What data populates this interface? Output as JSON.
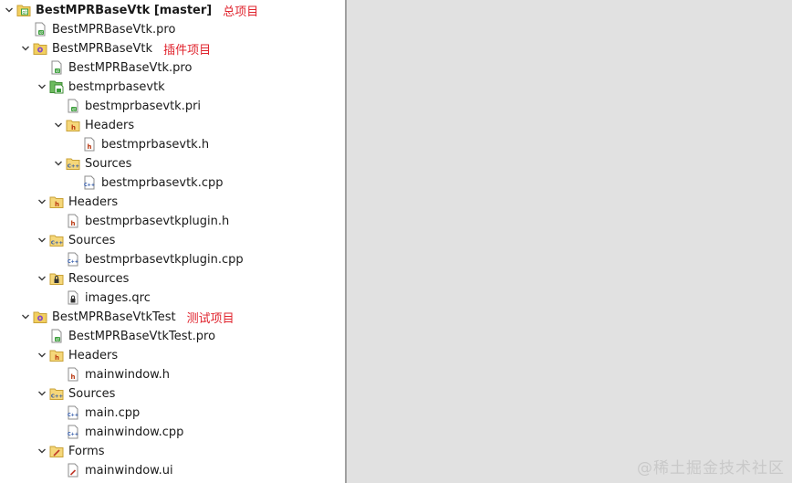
{
  "tree": [
    {
      "label": "BestMPRBaseVtk [master]",
      "icon": "qt-project-icon",
      "expanded": true,
      "bold": true,
      "annotation": "总项目"
    },
    {
      "label": "BestMPRBaseVtk.pro",
      "icon": "pro-file-icon"
    },
    {
      "label": "BestMPRBaseVtk",
      "icon": "subproject-icon",
      "expanded": true,
      "annotation": "插件项目"
    },
    {
      "label": "BestMPRBaseVtk.pro",
      "icon": "pro-file-icon"
    },
    {
      "label": "bestmprbasevtk",
      "icon": "pri-folder-icon",
      "expanded": true
    },
    {
      "label": "bestmprbasevtk.pri",
      "icon": "pro-file-icon"
    },
    {
      "label": "Headers",
      "icon": "headers-folder-icon",
      "expanded": true
    },
    {
      "label": "bestmprbasevtk.h",
      "icon": "header-file-icon"
    },
    {
      "label": "Sources",
      "icon": "sources-folder-icon",
      "expanded": true
    },
    {
      "label": "bestmprbasevtk.cpp",
      "icon": "cpp-file-icon"
    },
    {
      "label": "Headers",
      "icon": "headers-folder-icon",
      "expanded": true
    },
    {
      "label": "bestmprbasevtkplugin.h",
      "icon": "header-file-icon"
    },
    {
      "label": "Sources",
      "icon": "sources-folder-icon",
      "expanded": true
    },
    {
      "label": "bestmprbasevtkplugin.cpp",
      "icon": "cpp-file-icon"
    },
    {
      "label": "Resources",
      "icon": "resources-folder-icon",
      "expanded": true
    },
    {
      "label": "images.qrc",
      "icon": "qrc-file-icon"
    },
    {
      "label": "BestMPRBaseVtkTest",
      "icon": "subproject-icon",
      "expanded": true,
      "annotation": "测试项目"
    },
    {
      "label": "BestMPRBaseVtkTest.pro",
      "icon": "pro-file-icon"
    },
    {
      "label": "Headers",
      "icon": "headers-folder-icon",
      "expanded": true
    },
    {
      "label": "mainwindow.h",
      "icon": "header-file-icon"
    },
    {
      "label": "Sources",
      "icon": "sources-folder-icon",
      "expanded": true
    },
    {
      "label": "main.cpp",
      "icon": "cpp-file-icon"
    },
    {
      "label": "mainwindow.cpp",
      "icon": "cpp-file-icon"
    },
    {
      "label": "Forms",
      "icon": "forms-folder-icon",
      "expanded": true
    },
    {
      "label": "mainwindow.ui",
      "icon": "ui-file-icon"
    }
  ],
  "watermark": "@稀土掘金技术社区",
  "colors": {
    "annotation": "#e0242e",
    "editor_background": "#e1e1e1",
    "folder_yellow": "#f5d77a",
    "pro_green": "#3a9e3a"
  }
}
